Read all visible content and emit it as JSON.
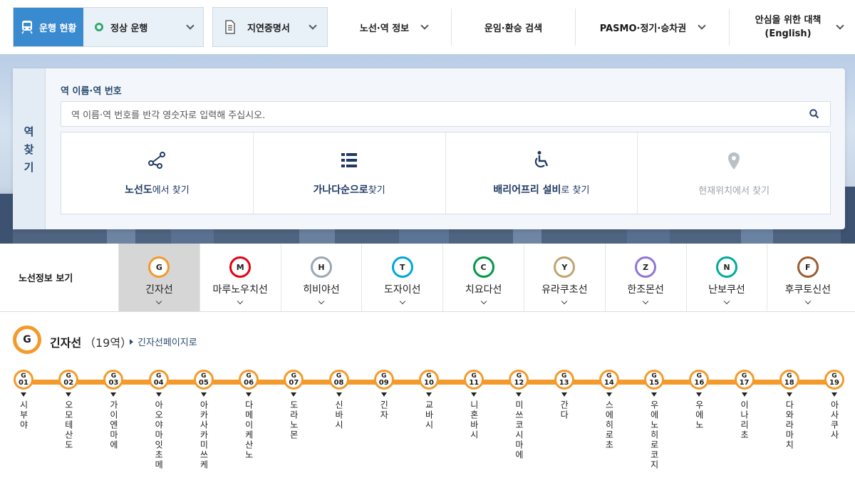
{
  "nav": {
    "status_label": "운행 현황",
    "status_value": "정상 운행",
    "delay_label": "지연증명서",
    "items": [
      {
        "label": "노선·역 정보"
      },
      {
        "label": "운임·환승 검색"
      },
      {
        "label": "PASMO·정기·승차권"
      },
      {
        "label": "안심을 위한 대책 (English)"
      }
    ]
  },
  "station_search": {
    "side_label": [
      "역",
      "찾",
      "기"
    ],
    "title": "역 이름·역 번호",
    "placeholder": "역 이름·역 번호를 반각 영숫자로 입력해 주십시오.",
    "options": [
      {
        "bold": "노선도",
        "rest": "에서 찾기",
        "icon": "route-map-icon"
      },
      {
        "bold": "가나다순으로",
        "rest": "찾기",
        "icon": "list-icon"
      },
      {
        "bold": "배리어프리 설비",
        "rest": "로 찾기",
        "icon": "wheelchair-icon"
      },
      {
        "bold": "",
        "rest": "현재위치에서 찾기",
        "icon": "location-pin-icon"
      }
    ]
  },
  "lines": {
    "label": "노선정보 보기",
    "tabs": [
      {
        "code": "G",
        "name": "긴자선",
        "color": "#f39a2b",
        "active": true
      },
      {
        "code": "M",
        "name": "마루노우치선",
        "color": "#e60012"
      },
      {
        "code": "H",
        "name": "히비야선",
        "color": "#9ca7b4"
      },
      {
        "code": "T",
        "name": "도자이선",
        "color": "#00a7db"
      },
      {
        "code": "C",
        "name": "치요다선",
        "color": "#009944"
      },
      {
        "code": "Y",
        "name": "유라쿠초선",
        "color": "#c1a470"
      },
      {
        "code": "Z",
        "name": "한조몬선",
        "color": "#8f76d6"
      },
      {
        "code": "N",
        "name": "난보쿠선",
        "color": "#00ac9b"
      },
      {
        "code": "F",
        "name": "후쿠토신선",
        "color": "#9c5e31"
      }
    ]
  },
  "line_detail": {
    "code": "G",
    "title": "긴자선",
    "count": "（19역）",
    "link": "긴자선페이지로",
    "color": "#f39a2b",
    "stations": [
      {
        "num": "01",
        "name": "시부야"
      },
      {
        "num": "02",
        "name": "오모테산도"
      },
      {
        "num": "03",
        "name": "가이엔마에"
      },
      {
        "num": "04",
        "name": "아오야마잇초메"
      },
      {
        "num": "05",
        "name": "아카사카미쓰케"
      },
      {
        "num": "06",
        "name": "다메이케산노"
      },
      {
        "num": "07",
        "name": "도라노몬"
      },
      {
        "num": "08",
        "name": "신바시"
      },
      {
        "num": "09",
        "name": "긴자"
      },
      {
        "num": "10",
        "name": "교바시"
      },
      {
        "num": "11",
        "name": "니혼바시"
      },
      {
        "num": "12",
        "name": "미쓰코시마에"
      },
      {
        "num": "13",
        "name": "간다"
      },
      {
        "num": "14",
        "name": "스에히로초"
      },
      {
        "num": "15",
        "name": "우에노히로코지"
      },
      {
        "num": "16",
        "name": "우에노"
      },
      {
        "num": "17",
        "name": "이나리초"
      },
      {
        "num": "18",
        "name": "다와라마치"
      },
      {
        "num": "19",
        "name": "아사쿠사"
      }
    ]
  }
}
